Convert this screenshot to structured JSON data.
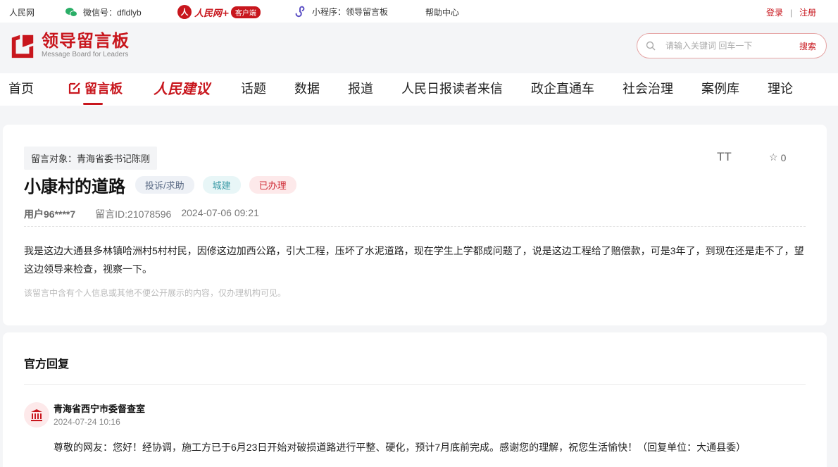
{
  "topbar": {
    "site": "人民网",
    "wechat": "微信号：dfldlyb",
    "rmw_brand": "人民网+",
    "rmw_client": "客户端",
    "miniprogram": "小程序：领导留言板",
    "help": "帮助中心",
    "login": "登录",
    "separator": "|",
    "register": "注册"
  },
  "header": {
    "logo_title": "领导留言板",
    "logo_subtitle": "Message Board for Leaders",
    "search_placeholder": "请输入关键词 回车一下",
    "search_button": "搜索"
  },
  "nav": {
    "items": [
      "首页",
      "留言板",
      "人民建议",
      "话题",
      "数据",
      "报道",
      "人民日报读者来信",
      "政企直通车",
      "社会治理",
      "案例库",
      "理论"
    ],
    "active_index": 1
  },
  "message": {
    "target": "留言对象：青海省委书记陈刚",
    "title": "小康村的道路",
    "tags": {
      "type": "投诉/求助",
      "domain": "城建",
      "status": "已办理"
    },
    "user": "用户96****7",
    "id": "留言ID:21078596",
    "time": "2024-07-06 09:21",
    "font_tool": "TT",
    "favorites": "0",
    "content": "我是这边大通县多林镇哈洲村5村村民，因修这边加西公路，引大工程，压坏了水泥道路，现在学生上学都成问题了，说是这边工程给了赔偿款，可是3年了，到现在还是走不了，望这边领导来检查，视察一下。",
    "notice": "该留言中含有个人信息或其他不便公开展示的内容，仅办理机构可见。"
  },
  "reply": {
    "heading": "官方回复",
    "org": "青海省西宁市委督查室",
    "time": "2024-07-24 10:16",
    "body": "尊敬的网友：您好！经协调，施工方已于6月23日开始对破损道路进行平整、硬化，预计7月底前完成。感谢您的理解，祝您生活愉快！（回复单位：大通县委）"
  },
  "colors": {
    "brand": "#c8161d",
    "page_bg": "#f4f5f7"
  }
}
